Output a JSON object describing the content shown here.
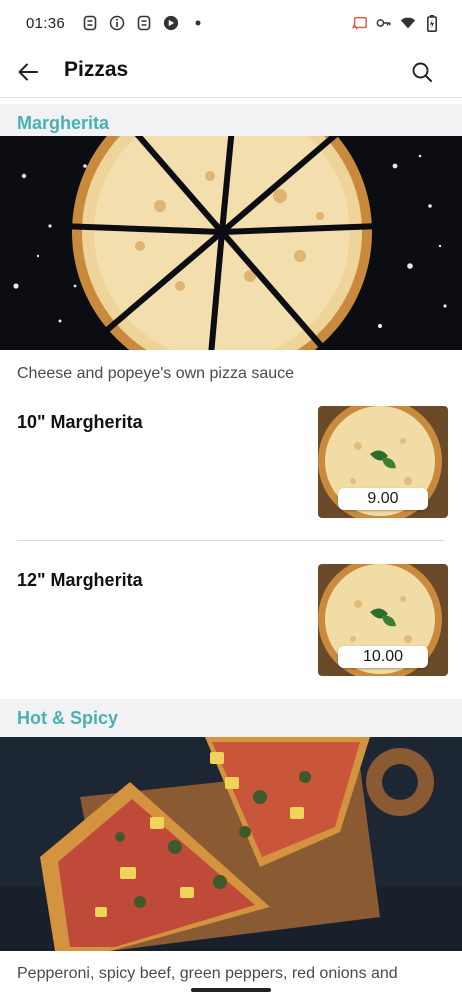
{
  "status_bar": {
    "time": "01:36",
    "left_icons": [
      "s-icon",
      "info-icon",
      "s-icon",
      "assistant-icon",
      "dot-icon"
    ],
    "right_icons": [
      "cast-icon",
      "vpn-key-icon",
      "wifi-icon",
      "battery-icon"
    ]
  },
  "header": {
    "title": "Pizzas",
    "back_icon": "arrow-left-icon",
    "search_icon": "search-icon"
  },
  "sections": [
    {
      "title": "Margherita",
      "description": "Cheese and popeye's own pizza sauce",
      "items": [
        {
          "name": "10\" Margherita",
          "price": "9.00"
        },
        {
          "name": "12\" Margherita",
          "price": "10.00"
        }
      ]
    },
    {
      "title": "Hot & Spicy",
      "description": "Pepperoni, spicy beef, green peppers, red onions and"
    }
  ],
  "colors": {
    "accent": "#4ab0b3",
    "section_bg": "#f2f2f4",
    "text": "#1c1c1c"
  }
}
